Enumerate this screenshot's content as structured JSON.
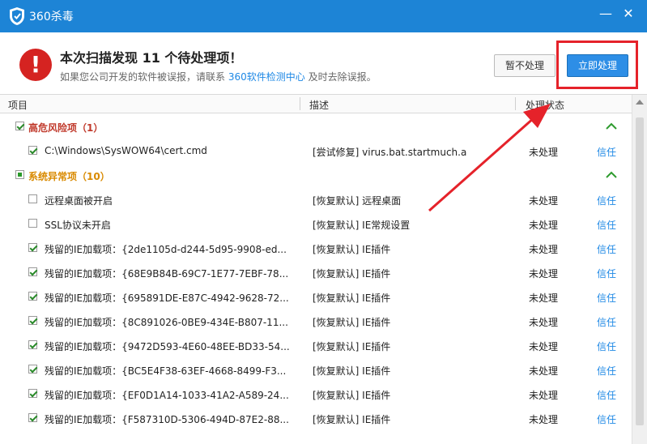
{
  "window": {
    "title": "360杀毒",
    "minimize": "—",
    "close": "✕"
  },
  "header": {
    "headline": "本次扫描发现 11 个待处理项！",
    "sub_prefix": "如果您公司开发的软件被误报，请联系",
    "sub_link": "360软件检测中心",
    "sub_suffix": "及时去除误报。",
    "alert_icon": "!",
    "ignore_button": "暂不处理",
    "fix_button": "立即处理"
  },
  "columns": {
    "item": "项目",
    "desc": "描述",
    "status": "处理状态"
  },
  "groups": [
    {
      "title": "高危风险项（1）"
    },
    {
      "title": "系统异常项（10）"
    }
  ],
  "rows": [
    {
      "name": "C:\\Windows\\SysWOW64\\cert.cmd",
      "desc": "[尝试修复] virus.bat.startmuch.a",
      "status": "未处理",
      "action": "信任",
      "checked": true
    },
    {
      "name": "远程桌面被开启",
      "desc": "[恢复默认] 远程桌面",
      "status": "未处理",
      "action": "信任",
      "checked": false
    },
    {
      "name": "SSL协议未开启",
      "desc": "[恢复默认] IE常规设置",
      "status": "未处理",
      "action": "信任",
      "checked": false
    },
    {
      "name": "残留的IE加载项：{2de1105d-d244-5d95-9908-ed...",
      "desc": "[恢复默认] IE插件",
      "status": "未处理",
      "action": "信任",
      "checked": true
    },
    {
      "name": "残留的IE加载项：{68E9B84B-69C7-1E77-7EBF-78...",
      "desc": "[恢复默认] IE插件",
      "status": "未处理",
      "action": "信任",
      "checked": true
    },
    {
      "name": "残留的IE加载项：{695891DE-E87C-4942-9628-72...",
      "desc": "[恢复默认] IE插件",
      "status": "未处理",
      "action": "信任",
      "checked": true
    },
    {
      "name": "残留的IE加载项：{8C891026-0BE9-434E-B807-11...",
      "desc": "[恢复默认] IE插件",
      "status": "未处理",
      "action": "信任",
      "checked": true
    },
    {
      "name": "残留的IE加载项：{9472D593-4E60-48EE-BD33-54...",
      "desc": "[恢复默认] IE插件",
      "status": "未处理",
      "action": "信任",
      "checked": true
    },
    {
      "name": "残留的IE加载项：{BC5E4F38-63EF-4668-8499-F3...",
      "desc": "[恢复默认] IE插件",
      "status": "未处理",
      "action": "信任",
      "checked": true
    },
    {
      "name": "残留的IE加载项：{EF0D1A14-1033-41A2-A589-24...",
      "desc": "[恢复默认] IE插件",
      "status": "未处理",
      "action": "信任",
      "checked": true
    },
    {
      "name": "残留的IE加载项：{F587310D-5306-494D-87E2-88...",
      "desc": "[恢复默认] IE插件",
      "status": "未处理",
      "action": "信任",
      "checked": true
    }
  ],
  "colors": {
    "titlebar": "#1d84d6",
    "alert": "#d52321",
    "highlight": "#e5222a",
    "link": "#1e88e5"
  }
}
